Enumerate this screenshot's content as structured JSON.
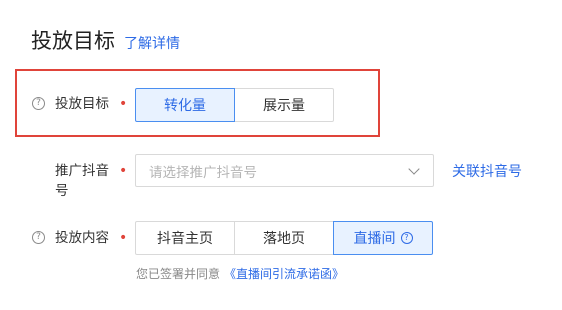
{
  "header": {
    "title": "投放目标",
    "detail_link": "了解详情"
  },
  "goal_row": {
    "label": "投放目标",
    "required_mark": "•",
    "options": [
      "转化量",
      "展示量"
    ],
    "selected": "转化量"
  },
  "account_row": {
    "label_line1": "推广抖音",
    "label_line2": "号",
    "required_mark": "•",
    "placeholder": "请选择推广抖音号",
    "link": "关联抖音号"
  },
  "content_row": {
    "label": "投放内容",
    "required_mark": "•",
    "options": [
      "抖音主页",
      "落地页",
      "直播间"
    ],
    "selected": "直播间",
    "help_glyph": "?"
  },
  "agreement": {
    "text": "您已签署并同意",
    "link": "《直播间引流承诺函》"
  },
  "icons": {
    "help": "question-circle-icon",
    "chevron": "chevron-down-icon"
  },
  "colors": {
    "accent": "#2e6be6",
    "required": "#e0443a",
    "highlight": "#e0443a"
  }
}
